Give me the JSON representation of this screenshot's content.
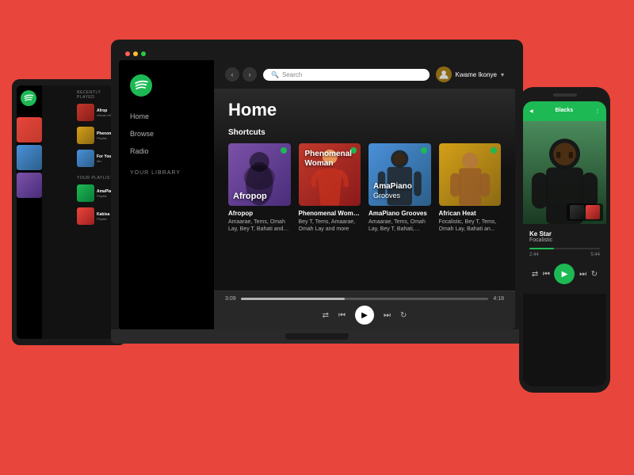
{
  "background_color": "#E8453C",
  "laptop": {
    "sidebar": {
      "nav": [
        "Home",
        "Browse",
        "Radio"
      ],
      "section_label": "YOUR LIBRARY",
      "playlists": []
    },
    "topbar": {
      "search_placeholder": "Search",
      "user_name": "Kwame Ikonye",
      "back_label": "‹",
      "forward_label": "›"
    },
    "main": {
      "page_title": "Home",
      "section_shortcuts": "Shortcuts",
      "cards": [
        {
          "title": "Afropop",
          "cover_label": "Afropop",
          "description": "Amaarae, Tems, Omah Lay, Bey T, Bahati and more",
          "color_from": "#7B52A8",
          "color_to": "#4A2C7A"
        },
        {
          "title": "Phenomenal Woman",
          "cover_label": "Phenomenal\nWoman",
          "description": "Bey T, Tems, Amaarae, Omah Lay and more",
          "color_from": "#C0392B",
          "color_to": "#8B1A1A"
        },
        {
          "title": "AmaPiano Grooves",
          "cover_label": "AmaPiano\nGrooves",
          "description": "Amaarae, Tems, Omah Lay, Bey T, Bahati, Focalistic and more",
          "color_from": "#4A90D9",
          "color_to": "#2C5F8A"
        },
        {
          "title": "African Heat",
          "cover_label": "African Heat",
          "description": "Focalistic, Bey T, Tems, Omah Lay, Bahati an...",
          "color_from": "#D4A017",
          "color_to": "#8B6914"
        }
      ]
    },
    "player": {
      "time_current": "3:09",
      "time_total": "4:18",
      "progress_pct": 42
    }
  },
  "phone": {
    "header_label": "Blacks",
    "now_playing": {
      "song": "Ke Star",
      "artist": "Focalistic",
      "time_current": "2:44",
      "time_total": "5:44",
      "progress_pct": 35
    }
  },
  "icons": {
    "shuffle": "⇄",
    "prev": "⏮",
    "play": "▶",
    "next": "⏭",
    "repeat": "↻",
    "search": "🔍",
    "chevron_down": "▾",
    "skip_back": "⏮",
    "skip_fwd": "⏭"
  }
}
